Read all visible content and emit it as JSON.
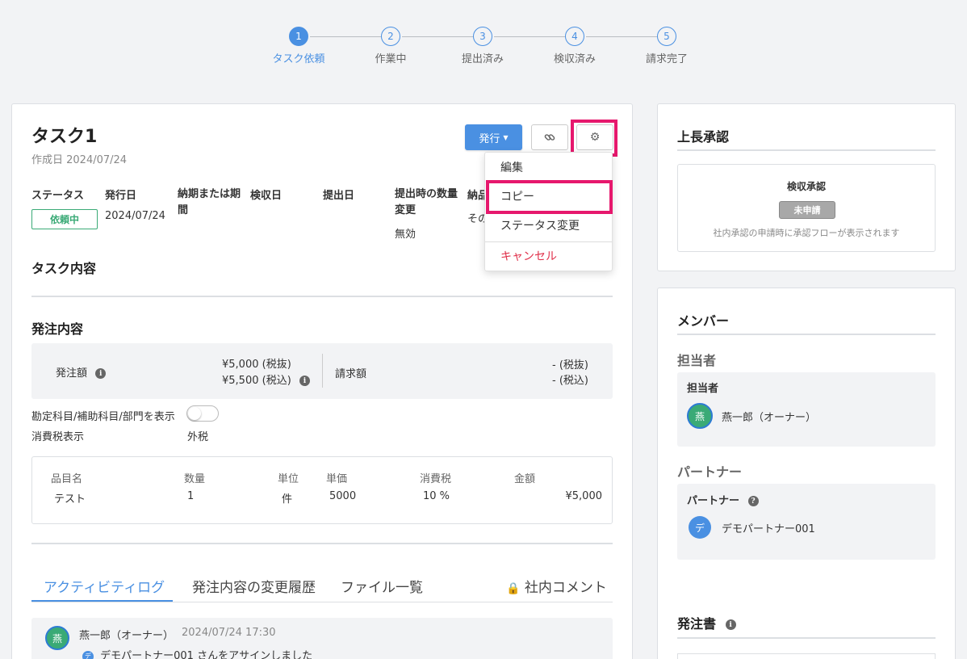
{
  "stepper": {
    "steps": [
      {
        "num": "1",
        "label": "タスク依頼",
        "active": true
      },
      {
        "num": "2",
        "label": "作業中",
        "active": false
      },
      {
        "num": "3",
        "label": "提出済み",
        "active": false
      },
      {
        "num": "4",
        "label": "検収済み",
        "active": false
      },
      {
        "num": "5",
        "label": "請求完了",
        "active": false
      }
    ]
  },
  "task": {
    "title": "タスク1",
    "created": "作成日 2024/07/24",
    "publish_button": "発行",
    "fields": {
      "status_label": "ステータス",
      "status_value": "依頼中",
      "issue_date_label": "発行日",
      "issue_date_value": "2024/07/24",
      "deadline_label": "納期または期間",
      "inspection_label": "検収日",
      "submit_label": "提出日",
      "qty_change_label": "提出時の数量変更",
      "qty_change_value": "無効",
      "extra_label": "納品",
      "extra_value": "その"
    },
    "content_title": "タスク内容"
  },
  "menu": {
    "items": [
      "編集",
      "コピー",
      "ステータス変更"
    ],
    "cancel": "キャンセル"
  },
  "order": {
    "title": "発注内容",
    "amount_label": "発注額",
    "amount_excl": "¥5,000 (税抜)",
    "amount_incl": "¥5,500 (税込)",
    "billing_label": "請求額",
    "billing_excl": "- (税抜)",
    "billing_incl": "- (税込)",
    "toggle_label": "勘定科目/補助科目/部門を表示",
    "tax_label": "消費税表示",
    "tax_value": "外税",
    "table": {
      "headers": [
        "品目名",
        "数量",
        "単位",
        "単価",
        "消費税",
        "金額"
      ],
      "row": [
        "テスト",
        "1",
        "件",
        "5000",
        "10 %",
        "¥5,000"
      ]
    }
  },
  "tabs": [
    "アクティビティログ",
    "発注内容の変更履歴",
    "ファイル一覧",
    "社内コメント"
  ],
  "activity": {
    "avatar": "燕",
    "user": "燕一郎（オーナー）",
    "time": "2024/07/24 17:30",
    "mini_avatar": "デ",
    "message": "デモパートナー001 さんをアサインしました"
  },
  "approval": {
    "title": "上長承認",
    "box_title": "検収承認",
    "badge": "未申請",
    "note": "社内承認の申請時に承認フローが表示されます"
  },
  "members": {
    "title": "メンバー",
    "assignee_section": "担当者",
    "assignee_box_label": "担当者",
    "assignee_avatar": "燕",
    "assignee_name": "燕一郎（オーナー）",
    "partner_section": "パートナー",
    "partner_box_label": "パートナー",
    "partner_avatar": "デ",
    "partner_name": "デモパートナー001"
  },
  "purchase_order": {
    "title": "発注書"
  },
  "colors": {
    "accent": "#4a90e2",
    "highlight": "#e6186d",
    "status_green": "#3aaa76",
    "danger": "#e0304a"
  }
}
